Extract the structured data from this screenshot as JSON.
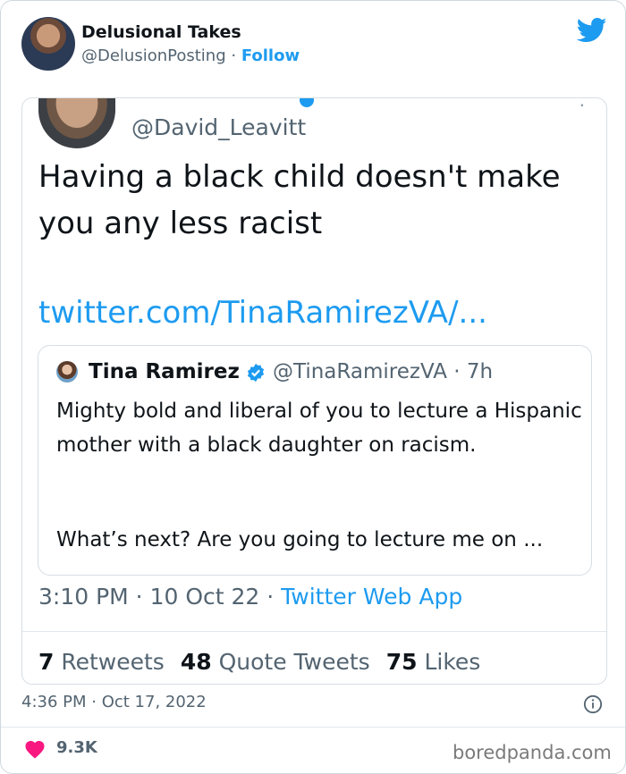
{
  "header": {
    "display_name": "Delusional Takes",
    "handle": "@DelusionPosting",
    "separator": " · ",
    "follow_label": "Follow"
  },
  "screenshot": {
    "author_handle": "@David_Leavitt",
    "tweet_text": "Having a black child doesn't make you any less racist",
    "link": "twitter.com/TinaRamirezVA/...",
    "quoted": {
      "name": "Tina Ramirez",
      "handle_time": "@TinaRamirezVA · 7h",
      "text": "Mighty bold and liberal of you to lecture a Hispanic mother with a black daughter on racism.",
      "more": "What’s next? Are you going to lecture me on ..."
    },
    "meta": {
      "time_date": "3:10 PM · 10 Oct 22 · ",
      "app": "Twitter Web App"
    },
    "stats": {
      "retweets_count": "7",
      "retweets_label": "Retweets",
      "quotes_count": "48",
      "quotes_label": "Quote Tweets",
      "likes_count": "75",
      "likes_label": "Likes"
    }
  },
  "footer": {
    "timestamp": "4:36 PM · Oct 17, 2022",
    "like_count": "9.3K",
    "watermark": "boredpanda.com"
  },
  "colors": {
    "accent": "#1d9bf0",
    "heart": "#f91880",
    "muted": "#536471"
  },
  "icons": [
    "twitter-bird-icon",
    "verified-badge-icon",
    "info-icon",
    "heart-icon"
  ]
}
